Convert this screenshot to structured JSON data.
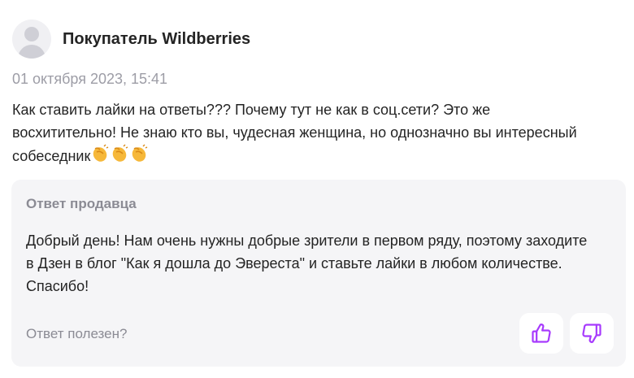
{
  "review": {
    "author": "Покупатель Wildberries",
    "date": "01 октября 2023, 15:41",
    "text": "Как ставить лайки на ответы??? Почему тут не как в соц.сети? Это же восхитительно! Не знаю кто вы, чудесная женщина, но однозначно вы интересный собеседник",
    "trailing_emojis": [
      "clapping-hands-icon",
      "clapping-hands-icon",
      "clapping-hands-icon"
    ]
  },
  "seller_reply": {
    "title": "Ответ продавца",
    "text": "Добрый день! Нам очень нужны добрые зрители в первом ряду, поэтому заходите в Дзен в блог \"Как я дошла до Эвереста\" и ставьте лайки в любом количестве. Спасибо!"
  },
  "feedback": {
    "question": "Ответ полезен?",
    "like_icon": "thumbs-up-icon",
    "dislike_icon": "thumbs-down-icon"
  },
  "colors": {
    "accent": "#a73afd",
    "emoji": "#f6b83a",
    "muted_text": "#9d9da6",
    "reply_bg": "#f5f5f7"
  }
}
